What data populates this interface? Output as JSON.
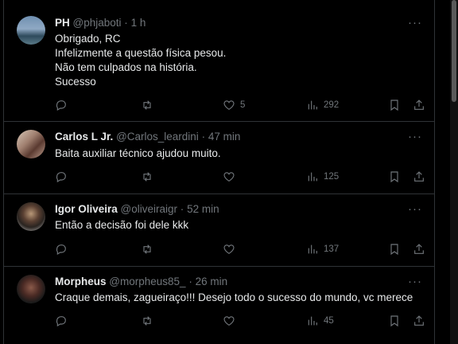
{
  "tweets": [
    {
      "name": "PH",
      "handle": "@phjaboti",
      "dot": "·",
      "time": "1 h",
      "lines": [
        "Obrigado, RC",
        "Infelizmente a questão física pesou.",
        "Não tem culpados na história.",
        "Sucesso"
      ],
      "likes": "5",
      "views": "292"
    },
    {
      "name": "Carlos L Jr.",
      "handle": "@Carlos_leardini",
      "dot": "·",
      "time": "47 min",
      "lines": [
        "Baita auxiliar técnico ajudou muito."
      ],
      "likes": "",
      "views": "125"
    },
    {
      "name": "Igor Oliveira",
      "handle": "@oliveiraigr",
      "dot": "·",
      "time": "52 min",
      "lines": [
        "Então a decisão foi dele kkk"
      ],
      "likes": "",
      "views": "137"
    },
    {
      "name": "Morpheus",
      "handle": "@morpheus85_",
      "dot": "·",
      "time": "26 min",
      "lines": [
        "Craque demais, zagueiraço!!! Desejo todo o sucesso do mundo, vc merece"
      ],
      "likes": "",
      "views": "45"
    }
  ],
  "more_glyph": "···",
  "icons": [
    "reply-icon",
    "retweet-icon",
    "like-icon",
    "views-icon",
    "bookmark-icon",
    "share-icon"
  ]
}
